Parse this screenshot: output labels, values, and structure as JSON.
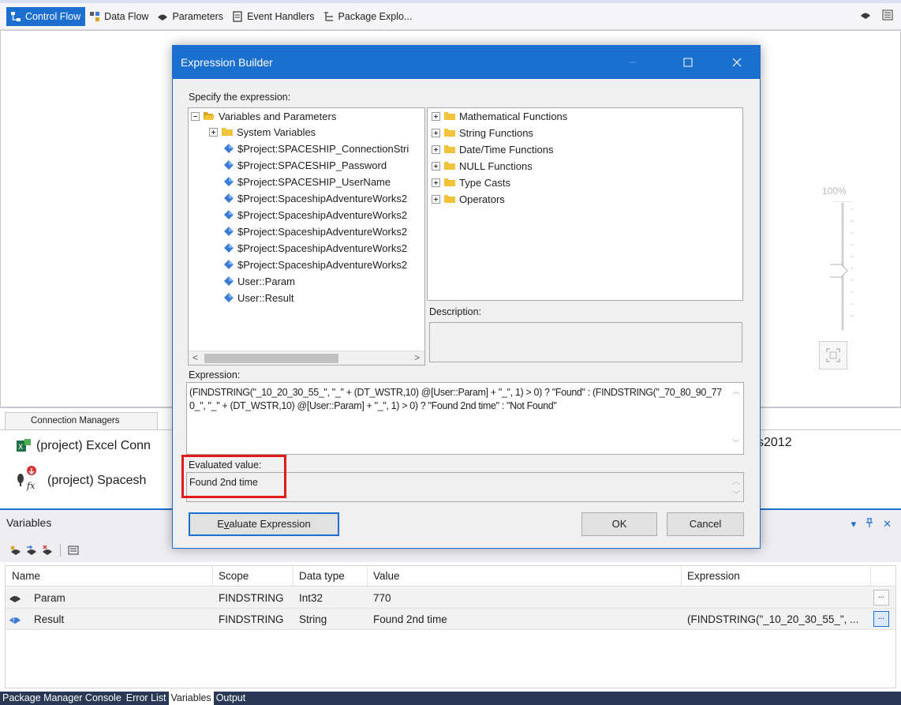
{
  "designer_tabs": [
    {
      "label": "Control Flow",
      "icon": "control-flow-icon",
      "active": true
    },
    {
      "label": "Data Flow",
      "icon": "data-flow-icon",
      "active": false
    },
    {
      "label": "Parameters",
      "icon": "parameters-icon",
      "active": false
    },
    {
      "label": "Event Handlers",
      "icon": "event-handlers-icon",
      "active": false
    },
    {
      "label": "Package Explo...",
      "icon": "package-explorer-icon",
      "active": false
    }
  ],
  "zoom": {
    "label": "100%"
  },
  "connection_managers": {
    "tab_label": "Connection Managers",
    "items": [
      {
        "label": "(project) Excel Conn",
        "icon": "excel-connection-icon"
      },
      {
        "label": "(project) Spacesh",
        "icon": "ole-db-connection-icon"
      }
    ],
    "right_text": "s2012"
  },
  "dialog": {
    "title": "Expression Builder",
    "specify_label": "Specify the expression:",
    "variables_tree": {
      "root": "Variables and Parameters",
      "system": "System Variables",
      "items": [
        "$Project:SPACESHIP_ConnectionStri",
        "$Project:SPACESHIP_Password",
        "$Project:SPACESHIP_UserName",
        "$Project:SpaceshipAdventureWorks2",
        "$Project:SpaceshipAdventureWorks2",
        "$Project:SpaceshipAdventureWorks2",
        "$Project:SpaceshipAdventureWorks2",
        "$Project:SpaceshipAdventureWorks2",
        "User::Param",
        "User::Result"
      ]
    },
    "functions": [
      "Mathematical Functions",
      "String Functions",
      "Date/Time Functions",
      "NULL Functions",
      "Type Casts",
      "Operators"
    ],
    "description_label": "Description:",
    "expression_label": "Expression:",
    "expression": "(FINDSTRING(\"_10_20_30_55_\", \"_\" + (DT_WSTR,10) @[User::Param] + \"_\", 1) > 0) ? \"Found\" : (FINDSTRING(\"_70_80_90_770_\", \"_\" + (DT_WSTR,10) @[User::Param] + \"_\", 1) > 0) ? \"Found 2nd time\" : \"Not Found\"",
    "evaluated_label": "Evaluated value:",
    "evaluated_value": "Found 2nd time",
    "evaluate_button_pre": "E",
    "evaluate_button_ul": "v",
    "evaluate_button_post": "aluate Expression",
    "ok_label": "OK",
    "cancel_label": "Cancel"
  },
  "variables": {
    "title": "Variables",
    "columns": [
      "Name",
      "Scope",
      "Data type",
      "Value",
      "Expression"
    ],
    "rows": [
      {
        "name": "Param",
        "scope": "FINDSTRING",
        "type": "Int32",
        "value": "770",
        "expression": ""
      },
      {
        "name": "Result",
        "scope": "FINDSTRING",
        "type": "String",
        "value": "Found 2nd time",
        "expression": "(FINDSTRING(\"_10_20_30_55_\", ..."
      }
    ],
    "ellipsis": "..."
  },
  "bottom_tabs": [
    {
      "label": "Package Manager Console",
      "active": false
    },
    {
      "label": "Error List",
      "active": false
    },
    {
      "label": "Variables",
      "active": true
    },
    {
      "label": "Output",
      "active": false
    }
  ],
  "colors": {
    "accent": "#1c6fd0",
    "highlight": "#e31a1a",
    "folder": "#f2c23a"
  }
}
